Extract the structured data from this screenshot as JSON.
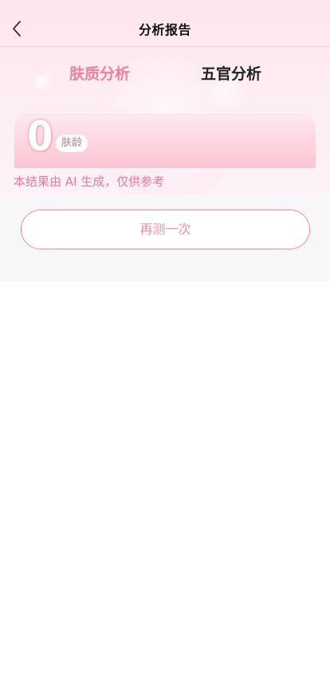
{
  "header": {
    "title": "分析报告",
    "back_icon": "chevron-left-icon"
  },
  "tabs": [
    {
      "label": "肤质分析",
      "active": true
    },
    {
      "label": "五官分析",
      "active": false
    }
  ],
  "skin_age": {
    "value": "0",
    "label": "肤龄"
  },
  "disclaimer": "本结果由 AI 生成，仅供参考",
  "actions": {
    "retest_label": "再测一次"
  },
  "colors": {
    "accent": "#ef7fa0",
    "hero_bg": "#fde6ec",
    "section_bg": "#f7f7f9",
    "button_border": "#e889aa"
  }
}
